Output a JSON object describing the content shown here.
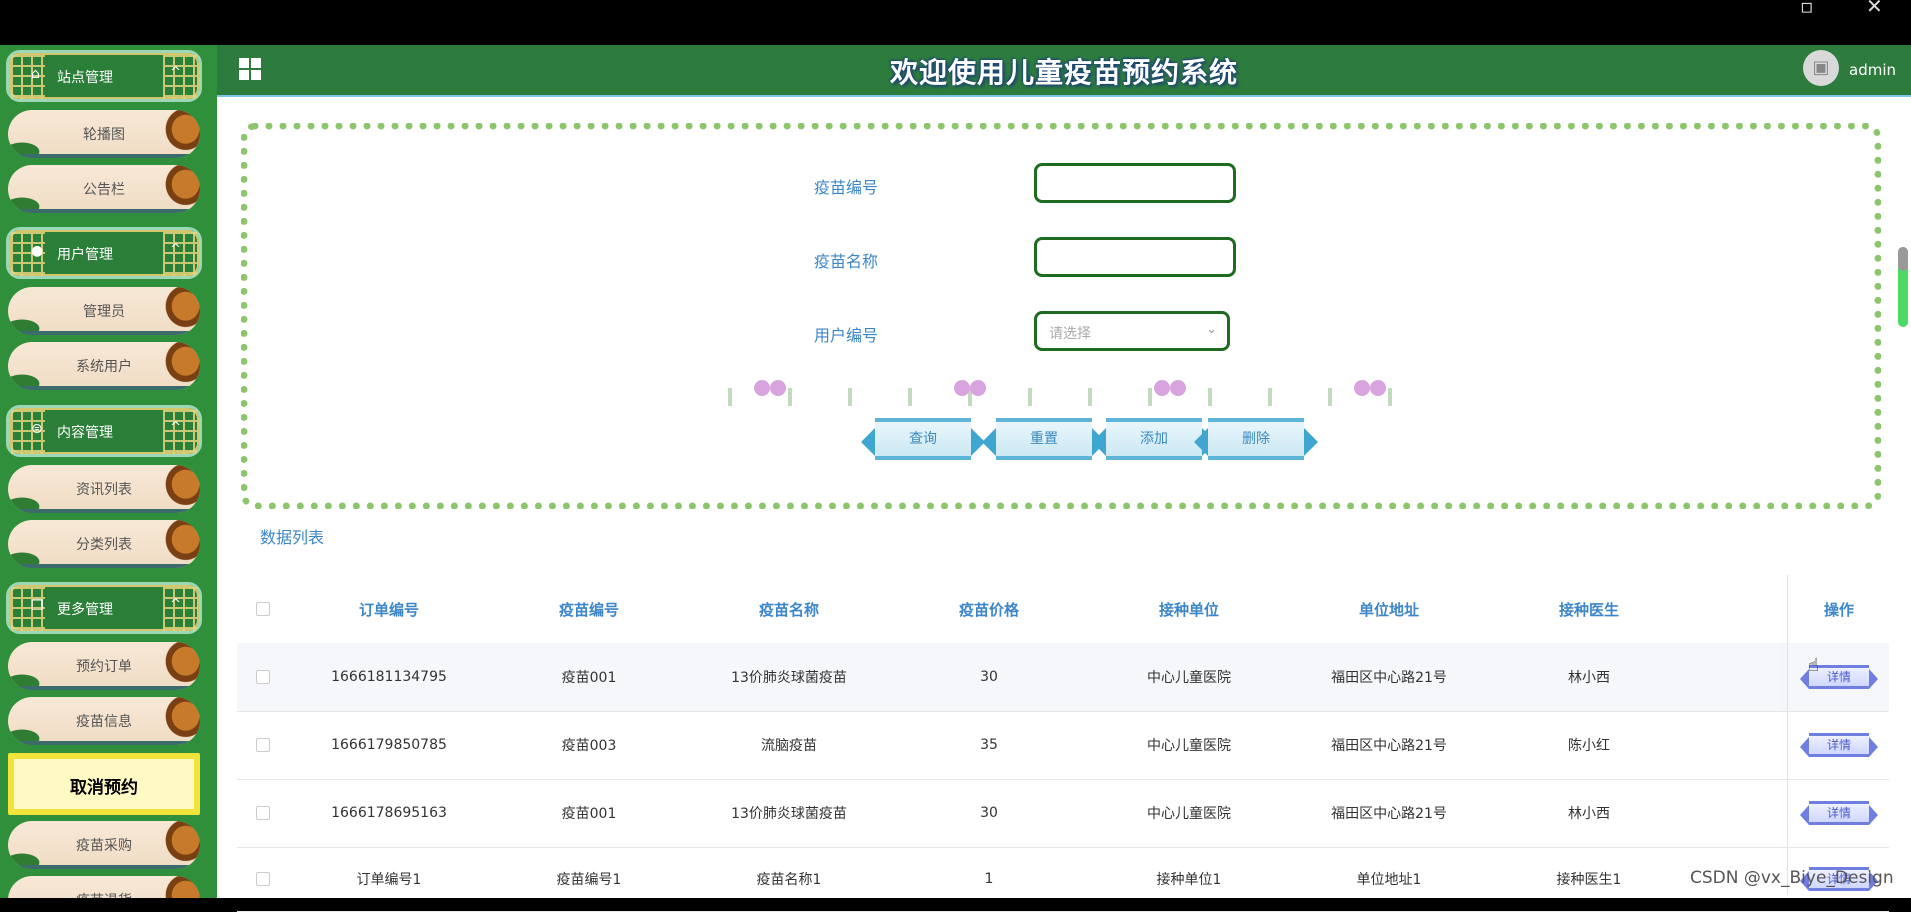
{
  "window": {
    "restore_icon": "restore-icon",
    "close_icon": "close-icon"
  },
  "sidebar": {
    "groups": [
      {
        "label": "站点管理",
        "icon": "monitor-icon"
      },
      {
        "label": "用户管理",
        "icon": "user-icon"
      },
      {
        "label": "内容管理",
        "icon": "message-icon"
      },
      {
        "label": "更多管理",
        "icon": "copy-icon"
      }
    ],
    "items": [
      "轮播图",
      "公告栏",
      "管理员",
      "系统用户",
      "资讯列表",
      "分类列表",
      "预约订单",
      "疫苗信息",
      "取消预约",
      "疫苗采购",
      "疫苗退货"
    ]
  },
  "header": {
    "title": "欢迎使用儿童疫苗预约系统",
    "user": "admin"
  },
  "search": {
    "vaccine_no_label": "疫苗编号",
    "vaccine_no_value": "",
    "vaccine_name_label": "疫苗名称",
    "vaccine_name_value": "",
    "user_no_label": "用户编号",
    "user_no_placeholder": "请选择"
  },
  "buttons": {
    "query": "查询",
    "reset": "重置",
    "add": "添加",
    "delete": "删除"
  },
  "list": {
    "title": "数据列表",
    "columns": [
      "订单编号",
      "疫苗编号",
      "疫苗名称",
      "疫苗价格",
      "接种单位",
      "单位地址",
      "接种医生",
      "操作"
    ],
    "rows": [
      [
        "1666181134795",
        "疫苗001",
        "13价肺炎球菌疫苗",
        "30",
        "中心儿童医院",
        "福田区中心路21号",
        "林小西"
      ],
      [
        "1666179850785",
        "疫苗003",
        "流脑疫苗",
        "35",
        "中心儿童医院",
        "福田区中心路21号",
        "陈小红"
      ],
      [
        "1666178695163",
        "疫苗001",
        "13价肺炎球菌疫苗",
        "30",
        "中心儿童医院",
        "福田区中心路21号",
        "林小西"
      ],
      [
        "订单编号1",
        "疫苗编号1",
        "疫苗名称1",
        "1",
        "接种单位1",
        "单位地址1",
        "接种医生1"
      ]
    ],
    "detail_label": "详情"
  },
  "watermark": "CSDN @vx_Biye_Design",
  "colors": {
    "sidebar": "#2f8f3a",
    "header": "#2d7c3d",
    "accent": "#3d86c9"
  }
}
